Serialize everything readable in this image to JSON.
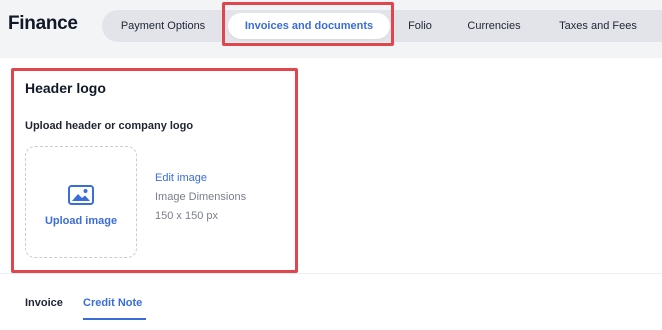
{
  "app": {
    "title": "Finance"
  },
  "tabs": [
    {
      "label": "Payment Options",
      "active": false
    },
    {
      "label": "Invoices and documents",
      "active": true
    },
    {
      "label": "Folio",
      "active": false
    },
    {
      "label": "Currencies",
      "active": false
    },
    {
      "label": "Taxes and Fees",
      "active": false
    }
  ],
  "header_logo": {
    "title": "Header logo",
    "subtitle": "Upload header or company logo",
    "upload_label": "Upload image",
    "upload_icon": "image-icon",
    "edit_label": "Edit image",
    "dimensions_label": "Image Dimensions",
    "dimensions_value": "150 x 150 px"
  },
  "document_tabs": [
    {
      "label": "Invoice",
      "active": false
    },
    {
      "label": "Credit Note",
      "active": true
    }
  ],
  "colors": {
    "accent": "#3b6cdb",
    "highlight": "#e0464c",
    "tab_bar": "#e2e4e9",
    "page_bg": "#f3f4f6"
  }
}
